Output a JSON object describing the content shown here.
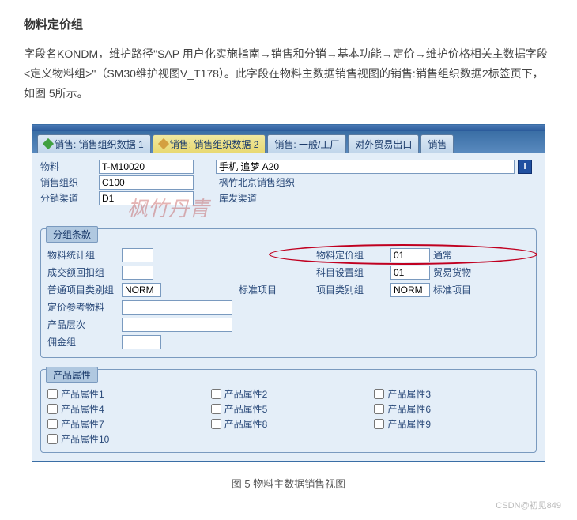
{
  "article": {
    "title": "物料定价组",
    "paragraph": "字段名KONDM，维护路径\"SAP 用户化实施指南→销售和分销→基本功能→定价→维护价格相关主数据字段<定义物料组>\"（SM30维护视图V_T178）。此字段在物料主数据销售视图的销售:销售组织数据2标签页下，如图 5所示。",
    "caption": "图 5 物料主数据销售视图",
    "csdn": "CSDN@初见849"
  },
  "tabs": [
    {
      "label": "销售: 销售组织数据 1"
    },
    {
      "label": "销售: 销售组织数据 2"
    },
    {
      "label": "销售: 一般/工厂"
    },
    {
      "label": "对外贸易出口"
    },
    {
      "label": "销售"
    }
  ],
  "header": {
    "material_lbl": "物料",
    "material_val": "T-M10020",
    "material_desc": "手机 追梦 A20",
    "salesorg_lbl": "销售组织",
    "salesorg_val": "C100",
    "salesorg_desc": "枫竹北京销售组织",
    "distch_lbl": "分销渠道",
    "distch_val": "D1",
    "distch_desc": "库发渠道"
  },
  "watermark": "枫竹丹青",
  "group_panel": {
    "title": "分组条款",
    "rows": {
      "r1_l_lbl": "物料统计组",
      "r1_l_val": "",
      "r1_r_lbl": "物料定价组",
      "r1_r_val": "01",
      "r1_r_txt": "通常",
      "r2_l_lbl": "成交额回扣组",
      "r2_l_val": "",
      "r2_r_lbl": "科目设置组",
      "r2_r_val": "01",
      "r2_r_txt": "贸易货物",
      "r3_l_lbl": "普通项目类别组",
      "r3_l_val": "NORM",
      "r3_l_txt": "标准项目",
      "r3_r_lbl": "项目类别组",
      "r3_r_val": "NORM",
      "r3_r_txt": "标准项目",
      "r4_lbl": "定价参考物料",
      "r4_val": "",
      "r5_lbl": "产品层次",
      "r5_val": "",
      "r6_lbl": "佣金组",
      "r6_val": ""
    }
  },
  "attr_panel": {
    "title": "产品属性",
    "items": [
      "产品属性1",
      "产品属性2",
      "产品属性3",
      "产品属性4",
      "产品属性5",
      "产品属性6",
      "产品属性7",
      "产品属性8",
      "产品属性9",
      "产品属性10"
    ]
  }
}
